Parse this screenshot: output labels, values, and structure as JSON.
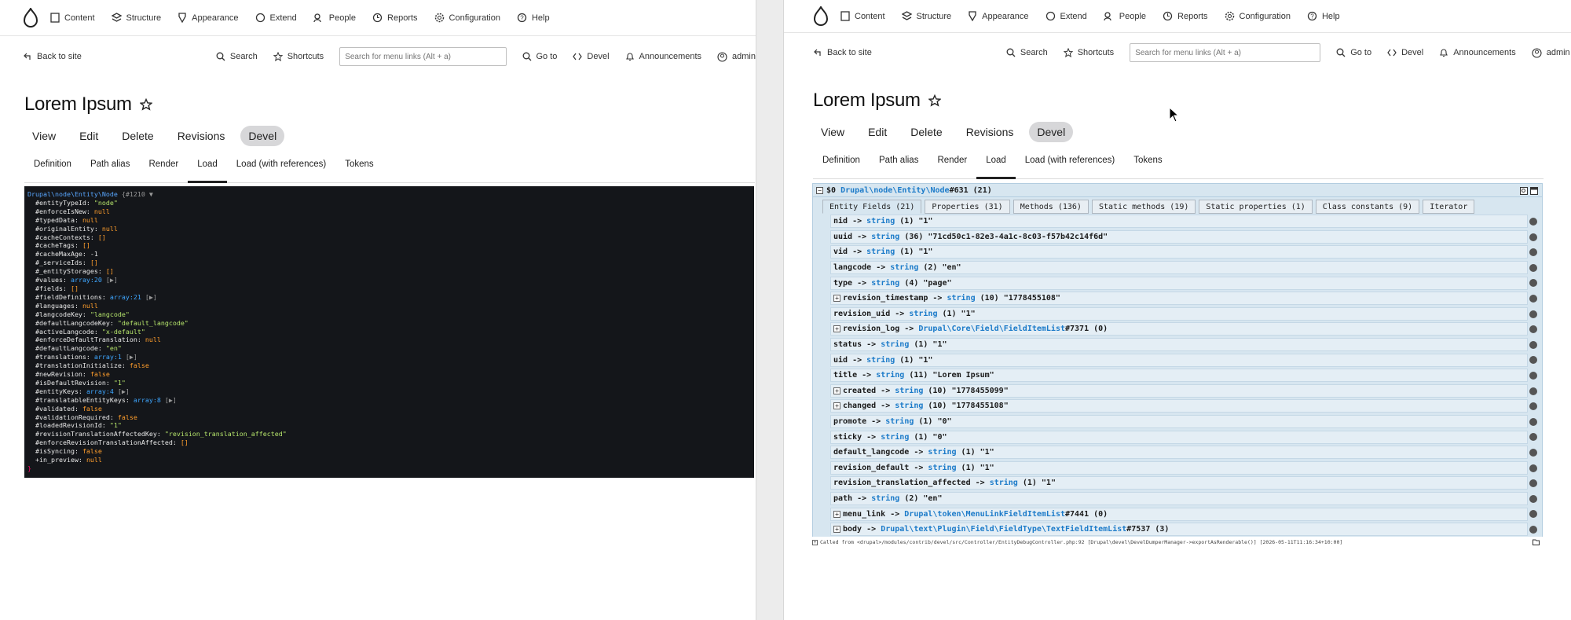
{
  "toolbar": {
    "items": [
      "Content",
      "Structure",
      "Appearance",
      "Extend",
      "People",
      "Reports",
      "Configuration",
      "Help"
    ]
  },
  "secondary": {
    "back": "Back to site",
    "search": "Search",
    "shortcuts": "Shortcuts",
    "search_placeholder": "Search for menu links (Alt + a)",
    "goto": "Go to",
    "devel": "Devel",
    "announcements": "Announcements",
    "user": "admin"
  },
  "page": {
    "title": "Lorem Ipsum",
    "primary_tabs": [
      "View",
      "Edit",
      "Delete",
      "Revisions",
      "Devel"
    ],
    "active_primary": "Devel",
    "secondary_tabs": [
      "Definition",
      "Path alias",
      "Render",
      "Load",
      "Load (with references)",
      "Tokens"
    ],
    "active_secondary": "Load"
  },
  "left_dump": {
    "lines": [
      "Drupal\\node\\Entity\\Node {#1210 ▼",
      "  #entityTypeId: \"node\"",
      "  #enforceIsNew: null",
      "  #typedData: null",
      "  #originalEntity: null",
      "  #cacheContexts: []",
      "  #cacheTags: []",
      "  #cacheMaxAge: -1",
      "  #_serviceIds: []",
      "  #_entityStorages: []",
      "  #values: array:20 [▶]",
      "  #fields: []",
      "  #fieldDefinitions: array:21 [▶]",
      "  #languages: null",
      "  #langcodeKey: \"langcode\"",
      "  #defaultLangcodeKey: \"default_langcode\"",
      "  #activeLangcode: \"x-default\"",
      "  #enforceDefaultTranslation: null",
      "  #defaultLangcode: \"en\"",
      "  #translations: array:1 [▶]",
      "  #translationInitialize: false",
      "  #newRevision: false",
      "  #isDefaultRevision: \"1\"",
      "  #entityKeys: array:4 [▶]",
      "  #translatableEntityKeys: array:8 [▶]",
      "  #validated: false",
      "  #validationRequired: false",
      "  #loadedRevisionId: \"1\"",
      "  #revisionTranslationAffectedKey: \"revision_translation_affected\"",
      "  #enforceRevisionTranslationAffected: []",
      "  #isSyncing: false",
      "  +in_preview: null",
      "}"
    ]
  },
  "kint": {
    "header_var": "$0",
    "header_class": "Drupal\\node\\Entity\\Node",
    "header_id": "#631 (21)",
    "tabs": [
      "Entity Fields (21)",
      "Properties (31)",
      "Methods (136)",
      "Static methods (19)",
      "Static properties (1)",
      "Class constants (9)",
      "Iterator"
    ],
    "rows": [
      {
        "expand": false,
        "name": "nid",
        "type": "string",
        "rest": "(1) \"1\""
      },
      {
        "expand": false,
        "name": "uuid",
        "type": "string",
        "rest": "(36) \"71cd50c1-82e3-4a1c-8c03-f57b42c14f6d\""
      },
      {
        "expand": false,
        "name": "vid",
        "type": "string",
        "rest": "(1) \"1\""
      },
      {
        "expand": false,
        "name": "langcode",
        "type": "string",
        "rest": "(2) \"en\""
      },
      {
        "expand": false,
        "name": "type",
        "type": "string",
        "rest": "(4) \"page\""
      },
      {
        "expand": true,
        "name": "revision_timestamp",
        "type": "string",
        "rest": "(10) \"1778455108\""
      },
      {
        "expand": false,
        "name": "revision_uid",
        "type": "string",
        "rest": "(1) \"1\""
      },
      {
        "expand": true,
        "name": "revision_log",
        "type": "Drupal\\Core\\Field\\FieldItemList",
        "rest": "#7371 (0)"
      },
      {
        "expand": false,
        "name": "status",
        "type": "string",
        "rest": "(1) \"1\""
      },
      {
        "expand": false,
        "name": "uid",
        "type": "string",
        "rest": "(1) \"1\""
      },
      {
        "expand": false,
        "name": "title",
        "type": "string",
        "rest": "(11) \"Lorem Ipsum\""
      },
      {
        "expand": true,
        "name": "created",
        "type": "string",
        "rest": "(10) \"1778455099\""
      },
      {
        "expand": true,
        "name": "changed",
        "type": "string",
        "rest": "(10) \"1778455108\""
      },
      {
        "expand": false,
        "name": "promote",
        "type": "string",
        "rest": "(1) \"0\""
      },
      {
        "expand": false,
        "name": "sticky",
        "type": "string",
        "rest": "(1) \"0\""
      },
      {
        "expand": false,
        "name": "default_langcode",
        "type": "string",
        "rest": "(1) \"1\""
      },
      {
        "expand": false,
        "name": "revision_default",
        "type": "string",
        "rest": "(1) \"1\""
      },
      {
        "expand": false,
        "name": "revision_translation_affected",
        "type": "string",
        "rest": "(1) \"1\""
      },
      {
        "expand": false,
        "name": "path",
        "type": "string",
        "rest": "(2) \"en\""
      },
      {
        "expand": true,
        "name": "menu_link",
        "type": "Drupal\\token\\MenuLinkFieldItemList",
        "rest": "#7441 (0)"
      },
      {
        "expand": true,
        "name": "body",
        "type": "Drupal\\text\\Plugin\\Field\\FieldType\\TextFieldItemList",
        "rest": "#7537 (3)"
      }
    ],
    "footer": "Called from <drupal>/modules/contrib/devel/src/Controller/EntityDebugController.php:92 [Drupal\\devel\\DevelDumperManager->exportAsRenderable()] [2026-05-11T11:16:34+10:00]"
  }
}
